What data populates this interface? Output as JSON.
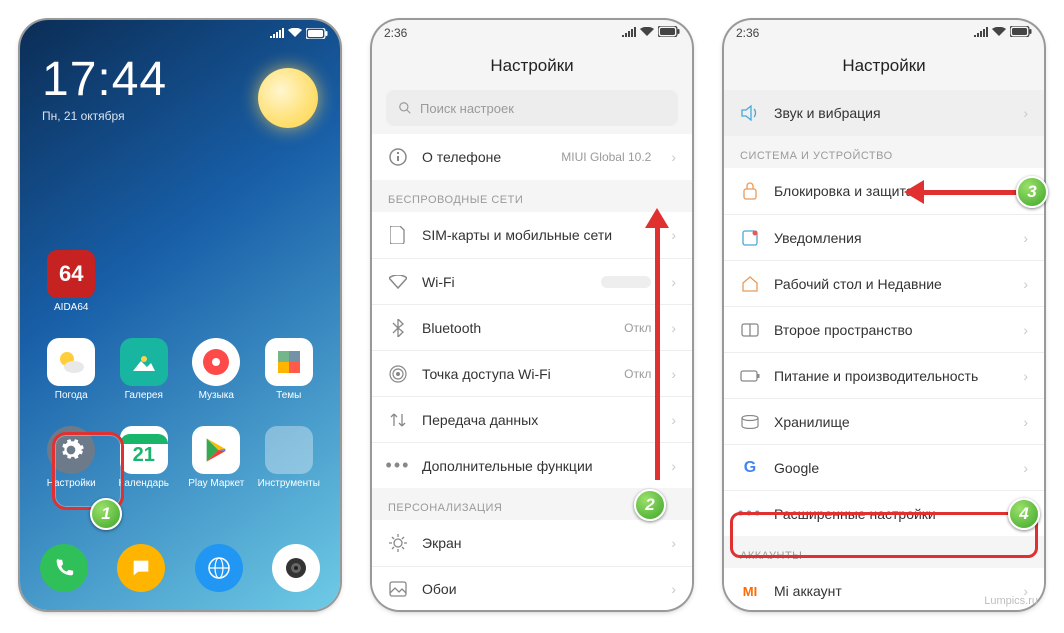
{
  "panel1": {
    "time": "17:44",
    "date": "Пн, 21 октября",
    "apps": {
      "aida": "AIDA64",
      "weather": "Погода",
      "gallery": "Галерея",
      "music": "Музыка",
      "themes": "Темы",
      "settings": "Настройки",
      "calendar": "Календарь",
      "play": "Play Маркет",
      "tools": "Инструменты"
    },
    "aida_badge": "64",
    "cal_day": "21"
  },
  "panel2": {
    "status_time": "2:36",
    "title": "Настройки",
    "search_placeholder": "Поиск настроек",
    "about_label": "О телефоне",
    "about_value": "MIUI Global 10.2",
    "section_wireless": "БЕСПРОВОДНЫЕ СЕТИ",
    "rows": {
      "sim": "SIM-карты и мобильные сети",
      "wifi": "Wi-Fi",
      "bt": "Bluetooth",
      "bt_val": "Откл",
      "hotspot": "Точка доступа Wi-Fi",
      "hotspot_val": "Откл",
      "data": "Передача данных",
      "more": "Дополнительные функции"
    },
    "section_personal": "ПЕРСОНАЛИЗАЦИЯ",
    "rows2": {
      "screen": "Экран",
      "wall": "Обои"
    }
  },
  "panel3": {
    "status_time": "2:36",
    "title": "Настройки",
    "rows": {
      "sound": "Звук и вибрация",
      "lock": "Блокировка и защита",
      "notif": "Уведомления",
      "desk": "Рабочий стол и Недавние",
      "space": "Второе пространство",
      "power": "Питание и производительность",
      "storage": "Хранилище",
      "google": "Google",
      "adv": "Расширенные настройки",
      "miacct": "Mi аккаунт"
    },
    "section_system": "СИСТЕМА И УСТРОЙСТВО",
    "section_accounts": "АККАУНТЫ"
  },
  "badges": {
    "b1": "1",
    "b2": "2",
    "b3": "3",
    "b4": "4"
  },
  "watermark": "Lumpics.ru"
}
